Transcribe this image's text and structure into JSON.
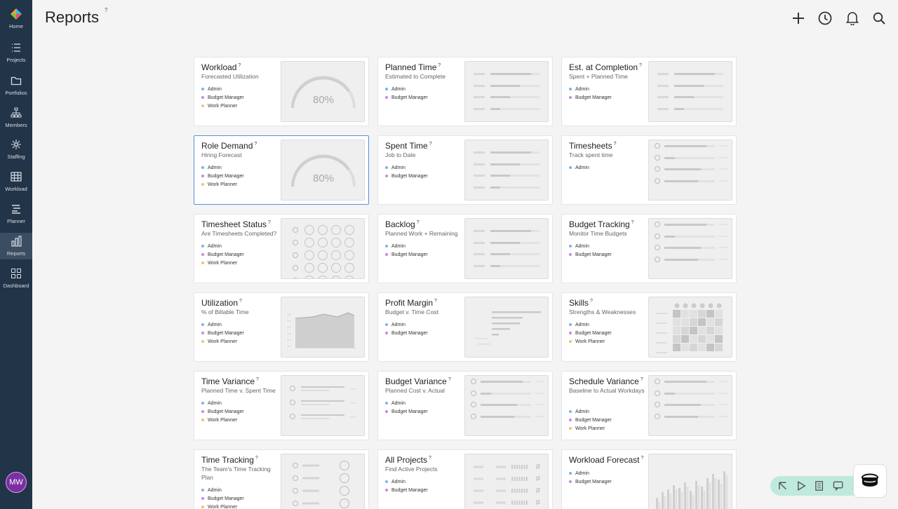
{
  "page": {
    "title": "Reports",
    "help": "?"
  },
  "sidebar": {
    "items": [
      {
        "label": "Home",
        "icon": "home-logo-icon"
      },
      {
        "label": "Projects",
        "icon": "list-icon"
      },
      {
        "label": "Portfolios",
        "icon": "folder-icon"
      },
      {
        "label": "Members",
        "icon": "org-chart-icon"
      },
      {
        "label": "Staffing",
        "icon": "staffing-icon"
      },
      {
        "label": "Workload",
        "icon": "grid-icon"
      },
      {
        "label": "Planner",
        "icon": "planner-icon"
      },
      {
        "label": "Reports",
        "icon": "bar-chart-icon",
        "active": true
      },
      {
        "label": "Dashboard",
        "icon": "dashboard-icon"
      }
    ],
    "avatar": "MW"
  },
  "header_actions": [
    "add-icon",
    "clock-icon",
    "bell-icon",
    "search-icon"
  ],
  "role_colors": {
    "Admin": "#7fb2e5",
    "Budget Manager": "#c58be0",
    "Work Planner": "#f0c36b"
  },
  "cards": [
    {
      "title": "Workload",
      "subtitle": "Forecasted Utilization",
      "roles": [
        "Admin",
        "Budget Manager",
        "Work Planner"
      ],
      "thumb": "gauge",
      "gauge_value": "80%"
    },
    {
      "title": "Planned Time",
      "subtitle": "Estimated to Complete",
      "roles": [
        "Admin",
        "Budget Manager"
      ],
      "thumb": "lines"
    },
    {
      "title": "Est. at Completion",
      "subtitle": "Spent + Planned Time",
      "roles": [
        "Admin",
        "Budget Manager"
      ],
      "thumb": "lines"
    },
    {
      "title": "Role Demand",
      "subtitle": "Hiring Forecast",
      "roles": [
        "Admin",
        "Budget Manager",
        "Work Planner"
      ],
      "thumb": "gauge",
      "gauge_value": "80%",
      "selected": true
    },
    {
      "title": "Spent Time",
      "subtitle": "Job to Date",
      "roles": [
        "Admin",
        "Budget Manager"
      ],
      "thumb": "lines"
    },
    {
      "title": "Timesheets",
      "subtitle": "Track spent time",
      "roles": [
        "Admin"
      ],
      "thumb": "people-bars"
    },
    {
      "title": "Timesheet Status",
      "subtitle": "Are Timesheets Completed?",
      "roles": [
        "Admin",
        "Budget Manager",
        "Work Planner"
      ],
      "thumb": "circles"
    },
    {
      "title": "Backlog",
      "subtitle": "Planned Work + Remaining",
      "roles": [
        "Admin",
        "Budget Manager"
      ],
      "thumb": "lines"
    },
    {
      "title": "Budget Tracking",
      "subtitle": "Monitor Time Budgets",
      "roles": [
        "Admin",
        "Budget Manager"
      ],
      "thumb": "people-bars"
    },
    {
      "title": "Utilization",
      "subtitle": "% of Billable Time",
      "roles": [
        "Admin",
        "Budget Manager",
        "Work Planner"
      ],
      "thumb": "area"
    },
    {
      "title": "Profit Margin",
      "subtitle": "Budget v. Time Cost",
      "roles": [
        "Admin",
        "Budget Manager"
      ],
      "thumb": "margin"
    },
    {
      "title": "Skills",
      "subtitle": "Strengths & Weaknesses",
      "roles": [
        "Admin",
        "Budget Manager",
        "Work Planner"
      ],
      "thumb": "heatmap"
    },
    {
      "title": "Time Variance",
      "subtitle": "Planned Time v. Spent Time",
      "roles": [
        "Admin",
        "Budget Manager",
        "Work Planner"
      ],
      "thumb": "variance"
    },
    {
      "title": "Budget Variance",
      "subtitle": "Planned Cost v. Actual",
      "roles": [
        "Admin",
        "Budget Manager"
      ],
      "thumb": "people-bars"
    },
    {
      "title": "Schedule Variance",
      "subtitle": "Baseline to Actual Workdays",
      "roles": [
        "Admin",
        "Budget Manager",
        "Work Planner"
      ],
      "thumb": "people-bars"
    },
    {
      "title": "Time Tracking",
      "subtitle": "The Team's Time Tracking Plan",
      "roles": [
        "Admin",
        "Budget Manager",
        "Work Planner"
      ],
      "thumb": "tracking"
    },
    {
      "title": "All Projects",
      "subtitle": "Find Active Projects",
      "roles": [
        "Admin",
        "Budget Manager"
      ],
      "thumb": "projects"
    },
    {
      "title": "Workload Forecast",
      "subtitle": "",
      "roles": [
        "Admin",
        "Budget Manager"
      ],
      "thumb": "bars"
    }
  ],
  "floating_toolbar": [
    "pointer-icon",
    "play-icon",
    "notes-icon",
    "comment-icon",
    "more-icon"
  ],
  "chat_button": "chat-icon"
}
